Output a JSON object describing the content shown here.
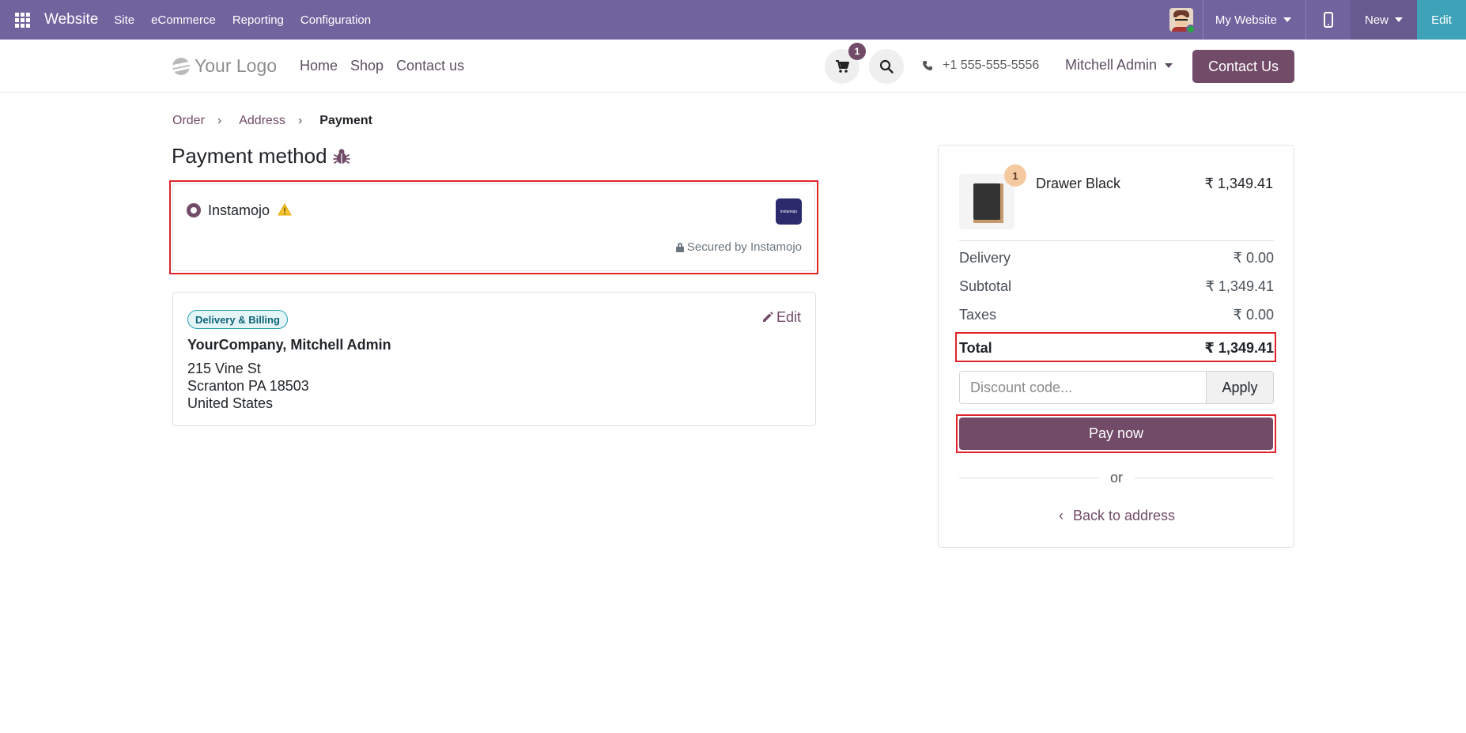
{
  "topbar": {
    "brand": "Website",
    "menu": [
      "Site",
      "eCommerce",
      "Reporting",
      "Configuration"
    ],
    "my_website": "My Website",
    "new_label": "New",
    "edit_label": "Edit"
  },
  "header": {
    "logo_text": "Your Logo",
    "nav": [
      "Home",
      "Shop",
      "Contact us"
    ],
    "cart_count": "1",
    "phone": "+1 555-555-5556",
    "user": "Mitchell Admin",
    "contact_btn": "Contact Us"
  },
  "breadcrumb": {
    "items": [
      "Order",
      "Address"
    ],
    "current": "Payment"
  },
  "page_title": "Payment method",
  "payment": {
    "provider": "Instamojo",
    "logo_text": "instamojo",
    "secured": "Secured by Instamojo"
  },
  "address": {
    "badge": "Delivery & Billing",
    "edit": "Edit",
    "name": "YourCompany, Mitchell Admin",
    "lines": [
      "215 Vine St",
      "Scranton PA 18503",
      "United States"
    ]
  },
  "summary": {
    "product_qty": "1",
    "product_name": "Drawer Black",
    "product_price": "₹ 1,349.41",
    "rows": [
      {
        "label": "Delivery",
        "value": "₹ 0.00"
      },
      {
        "label": "Subtotal",
        "value": "₹ 1,349.41"
      },
      {
        "label": "Taxes",
        "value": "₹ 0.00"
      }
    ],
    "total_label": "Total",
    "total_value": "₹ 1,349.41",
    "discount_placeholder": "Discount code...",
    "apply": "Apply",
    "pay_now": "Pay now",
    "or": "or",
    "back": "Back to address"
  },
  "colors": {
    "admin_bar": "#71639e",
    "brand": "#714b67",
    "edit": "#3ea3b8",
    "highlight": "#e0242a"
  }
}
